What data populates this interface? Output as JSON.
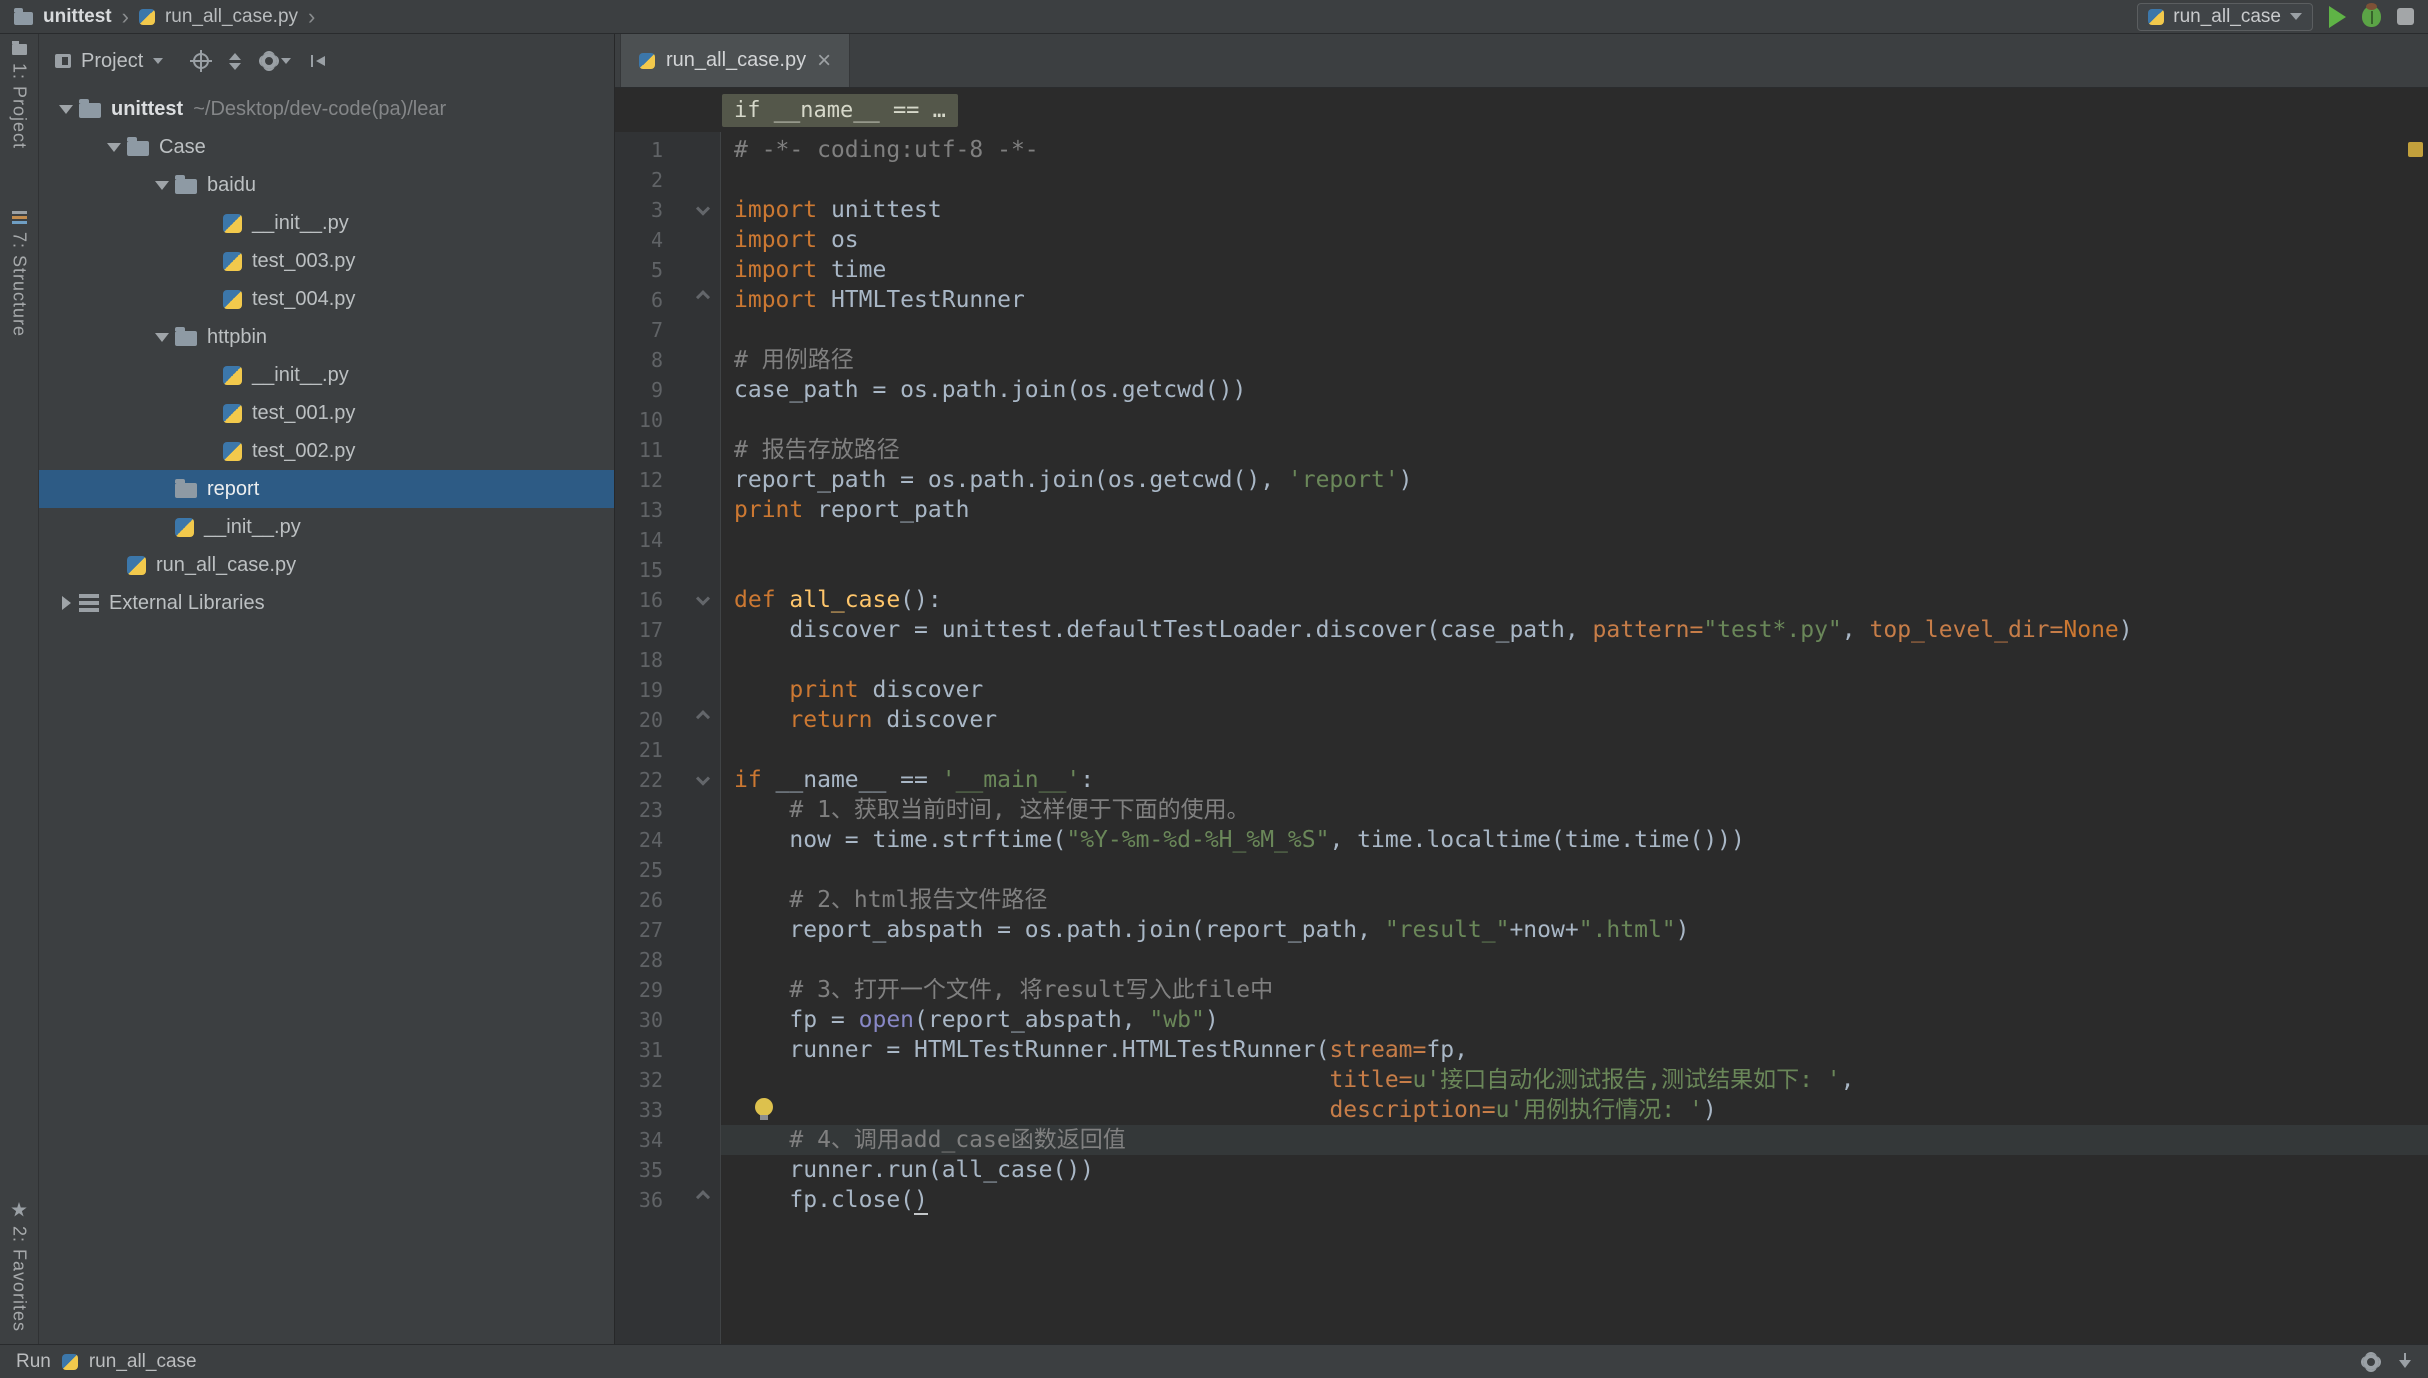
{
  "colors": {
    "editor_bg": "#2b2b2b",
    "panel_bg": "#3c3f41",
    "selection_blue": "#2d5b85",
    "run_green": "#5fb346",
    "keyword_orange": "#cc7832",
    "string_green": "#6a8759",
    "comment_gray": "#808080",
    "function_yellow": "#ffc66b",
    "builtin_purple": "#8888c6",
    "inspection_marker_orange": "#c2a03c"
  },
  "top_bar": {
    "separator": "›",
    "breadcrumb": [
      {
        "label": "unittest",
        "icon": "folder-icon"
      },
      {
        "label": "run_all_case.py",
        "icon": "python-icon"
      }
    ],
    "run_config": {
      "label": "run_all_case"
    }
  },
  "tool_strip": {
    "top": [
      {
        "label": "1: Project"
      },
      {
        "label": "7: Structure"
      }
    ],
    "bottom": [
      {
        "label": "2: Favorites"
      }
    ]
  },
  "project_panel": {
    "title": "Project",
    "tree": [
      {
        "label": "unittest",
        "suffix": "~/Desktop/dev-code(pa)/lear",
        "type": "folder",
        "level": 0,
        "arrow": "down",
        "bold": true
      },
      {
        "label": "Case",
        "type": "folder",
        "level": 1,
        "arrow": "down"
      },
      {
        "label": "baidu",
        "type": "folder",
        "level": 2,
        "arrow": "down"
      },
      {
        "label": "__init__.py",
        "type": "pyfile",
        "level": 3
      },
      {
        "label": "test_003.py",
        "type": "pyfile",
        "level": 3
      },
      {
        "label": "test_004.py",
        "type": "pyfile",
        "level": 3
      },
      {
        "label": "httpbin",
        "type": "folder",
        "level": 2,
        "arrow": "down"
      },
      {
        "label": "__init__.py",
        "type": "pyfile",
        "level": 3
      },
      {
        "label": "test_001.py",
        "type": "pyfile",
        "level": 3
      },
      {
        "label": "test_002.py",
        "type": "pyfile",
        "level": 3
      },
      {
        "label": "report",
        "type": "folder",
        "level": 2,
        "selected": true
      },
      {
        "label": "__init__.py",
        "type": "pyfile",
        "level": 2
      },
      {
        "label": "run_all_case.py",
        "type": "pyfile",
        "level": 1
      },
      {
        "label": "External Libraries",
        "type": "lib",
        "level": 0,
        "arrow": "right"
      }
    ]
  },
  "editor": {
    "tab": {
      "label": "run_all_case.py",
      "close": "×"
    },
    "context_line": "if __name__ == …",
    "code_lines": [
      {
        "n": 1,
        "tokens": [
          [
            "c",
            "# -*- coding:utf-8 -*-"
          ]
        ]
      },
      {
        "n": 2,
        "tokens": []
      },
      {
        "n": 3,
        "fold": "open",
        "tokens": [
          [
            "k",
            "import"
          ],
          [
            "p",
            " unittest"
          ]
        ]
      },
      {
        "n": 4,
        "tokens": [
          [
            "k",
            "import"
          ],
          [
            "p",
            " os"
          ]
        ]
      },
      {
        "n": 5,
        "tokens": [
          [
            "k",
            "import"
          ],
          [
            "p",
            " time"
          ]
        ]
      },
      {
        "n": 6,
        "fold": "close",
        "tokens": [
          [
            "k",
            "import"
          ],
          [
            "p",
            " HTMLTestRunner"
          ]
        ]
      },
      {
        "n": 7,
        "tokens": []
      },
      {
        "n": 8,
        "tokens": [
          [
            "c",
            "# 用例路径"
          ]
        ]
      },
      {
        "n": 9,
        "tokens": [
          [
            "p",
            "case_path = os.path.join(os.getcwd())"
          ]
        ]
      },
      {
        "n": 10,
        "tokens": []
      },
      {
        "n": 11,
        "tokens": [
          [
            "c",
            "# 报告存放路径"
          ]
        ]
      },
      {
        "n": 12,
        "tokens": [
          [
            "p",
            "report_path = os.path.join(os.getcwd(), "
          ],
          [
            "s",
            "'report'"
          ],
          [
            "p",
            ")"
          ]
        ]
      },
      {
        "n": 13,
        "tokens": [
          [
            "k",
            "print"
          ],
          [
            "p",
            " report_path"
          ]
        ]
      },
      {
        "n": 14,
        "tokens": []
      },
      {
        "n": 15,
        "tokens": []
      },
      {
        "n": 16,
        "fold": "open",
        "tokens": [
          [
            "k",
            "def "
          ],
          [
            "f",
            "all_case"
          ],
          [
            "p",
            "():"
          ]
        ]
      },
      {
        "n": 17,
        "tokens": [
          [
            "p",
            "    discover = unittest.defaultTestLoader.discover(case_path, "
          ],
          [
            "n",
            "pattern="
          ],
          [
            "s",
            "\"test*.py\""
          ],
          [
            "p",
            ", "
          ],
          [
            "n",
            "top_level_dir="
          ],
          [
            "k",
            "None"
          ],
          [
            "p",
            ")"
          ]
        ]
      },
      {
        "n": 18,
        "tokens": []
      },
      {
        "n": 19,
        "tokens": [
          [
            "p",
            "    "
          ],
          [
            "k",
            "print"
          ],
          [
            "p",
            " discover"
          ]
        ]
      },
      {
        "n": 20,
        "fold": "close",
        "tokens": [
          [
            "p",
            "    "
          ],
          [
            "k",
            "return"
          ],
          [
            "p",
            " discover"
          ]
        ]
      },
      {
        "n": 21,
        "tokens": []
      },
      {
        "n": 22,
        "fold": "open",
        "tokens": [
          [
            "k",
            "if"
          ],
          [
            "p",
            " __name__ == "
          ],
          [
            "s",
            "'__main__'"
          ],
          [
            "p",
            ":"
          ]
        ]
      },
      {
        "n": 23,
        "tokens": [
          [
            "p",
            "    "
          ],
          [
            "c",
            "# 1、获取当前时间, 这样便于下面的使用。"
          ]
        ]
      },
      {
        "n": 24,
        "tokens": [
          [
            "p",
            "    now = time.strftime("
          ],
          [
            "s",
            "\"%Y-%m-%d-%H_%M_%S\""
          ],
          [
            "p",
            ", time.localtime(time.time()))"
          ]
        ]
      },
      {
        "n": 25,
        "tokens": []
      },
      {
        "n": 26,
        "tokens": [
          [
            "p",
            "    "
          ],
          [
            "c",
            "# 2、html报告文件路径"
          ]
        ]
      },
      {
        "n": 27,
        "tokens": [
          [
            "p",
            "    report_abspath = os.path.join(report_path, "
          ],
          [
            "s",
            "\"result_\""
          ],
          [
            "p",
            "+now+"
          ],
          [
            "s",
            "\".html\""
          ],
          [
            "p",
            ")"
          ]
        ]
      },
      {
        "n": 28,
        "tokens": []
      },
      {
        "n": 29,
        "tokens": [
          [
            "p",
            "    "
          ],
          [
            "c",
            "# 3、打开一个文件, 将result写入此file中"
          ]
        ]
      },
      {
        "n": 30,
        "tokens": [
          [
            "p",
            "    fp = "
          ],
          [
            "b",
            "open"
          ],
          [
            "p",
            "(report_abspath, "
          ],
          [
            "s",
            "\"wb\""
          ],
          [
            "p",
            ")"
          ]
        ]
      },
      {
        "n": 31,
        "tokens": [
          [
            "p",
            "    runner = HTMLTestRunner.HTMLTestRunner("
          ],
          [
            "n",
            "stream="
          ],
          [
            "p",
            "fp,"
          ]
        ]
      },
      {
        "n": 32,
        "tokens": [
          [
            "p",
            "                                           "
          ],
          [
            "n",
            "title="
          ],
          [
            "s",
            "u'接口自动化测试报告,测试结果如下: '"
          ],
          [
            "p",
            ","
          ]
        ]
      },
      {
        "n": 33,
        "tokens": [
          [
            "p",
            "                                           "
          ],
          [
            "n",
            "description="
          ],
          [
            "s",
            "u'用例执行情况: '"
          ],
          [
            "p",
            ")"
          ]
        ]
      },
      {
        "n": 34,
        "current": true,
        "tokens": [
          [
            "p",
            "    "
          ],
          [
            "c",
            "# 4、调用add_case函数返回值"
          ]
        ]
      },
      {
        "n": 35,
        "tokens": [
          [
            "p",
            "    runner.run(all_case())"
          ]
        ]
      },
      {
        "n": 36,
        "fold": "close",
        "tokens": [
          [
            "p",
            "    fp.close("
          ],
          [
            "crt",
            ")"
          ]
        ]
      }
    ]
  },
  "status_bar": {
    "left_label": "Run",
    "target": "run_all_case"
  }
}
